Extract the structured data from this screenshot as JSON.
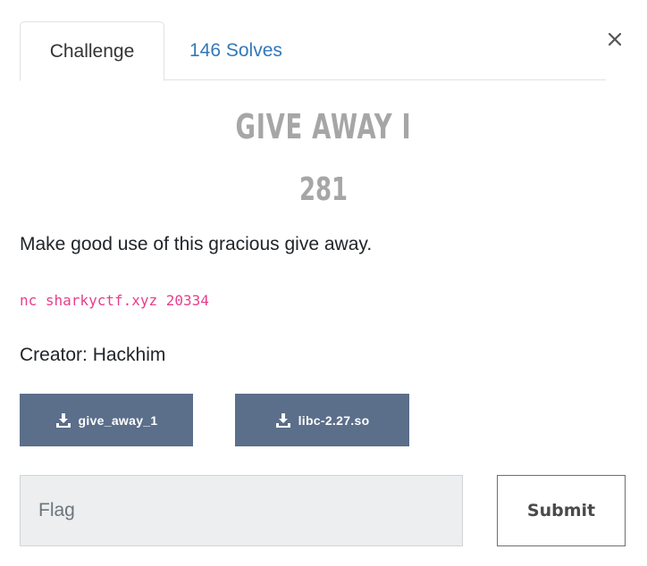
{
  "tabs": [
    {
      "label": "Challenge"
    },
    {
      "label": "146 Solves"
    }
  ],
  "challenge": {
    "title": "GIVE AWAY I",
    "points": "281",
    "description": "Make good use of this gracious give away.",
    "connection": "nc sharkyctf.xyz 20334",
    "creator": "Creator: Hackhim"
  },
  "files": [
    {
      "name": "give_away_1"
    },
    {
      "name": "libc-2.27.so"
    }
  ],
  "flag_form": {
    "placeholder": "Flag",
    "submit_label": "Submit"
  },
  "icons": {
    "close": "close-icon",
    "download": "download-icon"
  },
  "colors": {
    "tab_link": "#3378b8",
    "title_gray": "#a6a6a6",
    "code_pink": "#e83e8c",
    "file_button": "#5b6e8a"
  }
}
